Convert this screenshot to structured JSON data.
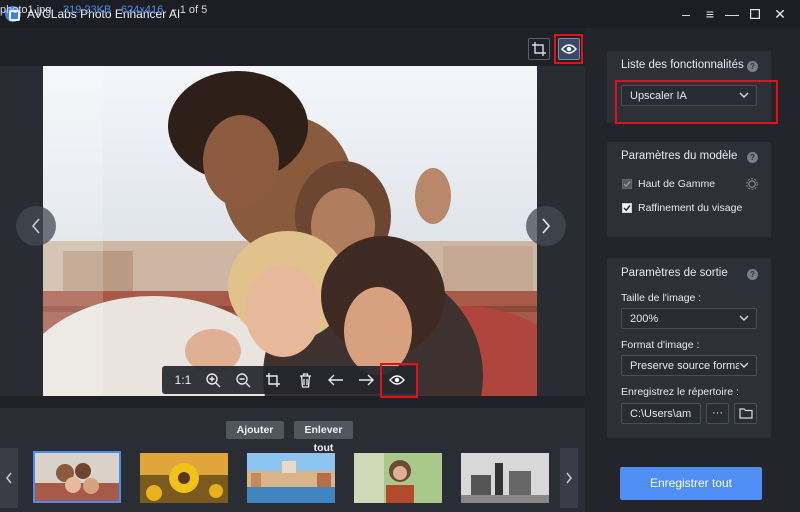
{
  "window": {
    "title": "AVCLabs Photo Enhancer AI"
  },
  "file_info": {
    "name": "photo1.jpg",
    "size": "319.23KB",
    "dimensions": "624x416",
    "index": "- 1 of 5"
  },
  "toolbar": {
    "zoom_label": "1:1"
  },
  "thumbnails": {
    "add_label": "Ajouter",
    "remove_all_label": "Enlever tout",
    "items": [
      "friends-selfie",
      "sunflower",
      "venice-canal",
      "woman-portrait",
      "city-grayscale"
    ]
  },
  "features": {
    "title": "Liste des fonctionnalités",
    "selected": "Upscaler IA"
  },
  "model": {
    "title": "Paramètres du modèle",
    "option_high_end": "Haut de Gamme",
    "option_face_refine": "Raffinement du visage"
  },
  "output": {
    "title": "Paramètres de sortie",
    "size_label": "Taille de l'image :",
    "size_value": "200%",
    "format_label": "Format d'image :",
    "format_value": "Preserve source format",
    "dir_label": "Enregistrez le répertoire :",
    "dir_value": "C:\\Users\\am",
    "browse_label": "···"
  },
  "save_all_label": "Enregistrer tout",
  "colors": {
    "accent": "#4f8ef5",
    "highlight_box": "#e0111a",
    "link_blue": "#4a8ff0"
  },
  "icons": [
    "app-logo",
    "minus-icon",
    "menu-icon",
    "maximize-icon",
    "close-icon",
    "crop-icon",
    "eye-icon",
    "zoom-in-icon",
    "zoom-out-icon",
    "trash-icon",
    "arrow-left-icon",
    "arrow-right-icon",
    "chevron-left-icon",
    "chevron-right-icon",
    "help-icon",
    "gear-icon",
    "folder-icon",
    "chevron-down-icon"
  ]
}
